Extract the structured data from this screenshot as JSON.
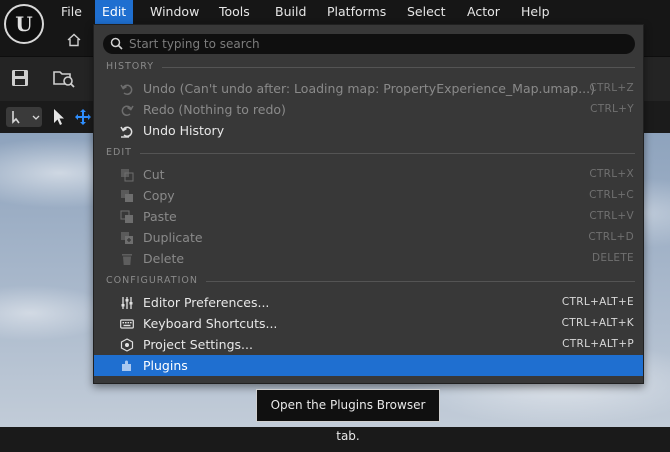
{
  "app": {
    "logo_glyph": "U",
    "menu": [
      {
        "label": "File"
      },
      {
        "label": "Edit",
        "active": true
      },
      {
        "label": "Window"
      },
      {
        "label": "Tools"
      },
      {
        "label": "Build"
      },
      {
        "label": "Platforms"
      },
      {
        "label": "Select"
      },
      {
        "label": "Actor"
      },
      {
        "label": "Help"
      }
    ],
    "accent_color": "#1f6fd0"
  },
  "edit_menu": {
    "search": {
      "placeholder": "Start typing to search",
      "value": ""
    },
    "sections": {
      "history": "HISTORY",
      "edit": "EDIT",
      "configuration": "CONFIGURATION"
    },
    "history_items": [
      {
        "label": "Undo (Can't undo after: Loading map: PropertyExperience_Map.umap...)",
        "shortcut": "CTRL+Z",
        "icon": "undo-icon",
        "enabled": false
      },
      {
        "label": "Redo (Nothing to redo)",
        "shortcut": "CTRL+Y",
        "icon": "redo-icon",
        "enabled": false
      },
      {
        "label": "Undo History",
        "shortcut": "",
        "icon": "undo-history-icon",
        "enabled": true
      }
    ],
    "edit_items": [
      {
        "label": "Cut",
        "shortcut": "CTRL+X",
        "icon": "cut-icon",
        "enabled": false
      },
      {
        "label": "Copy",
        "shortcut": "CTRL+C",
        "icon": "copy-icon",
        "enabled": false
      },
      {
        "label": "Paste",
        "shortcut": "CTRL+V",
        "icon": "paste-icon",
        "enabled": false
      },
      {
        "label": "Duplicate",
        "shortcut": "CTRL+D",
        "icon": "duplicate-icon",
        "enabled": false
      },
      {
        "label": "Delete",
        "shortcut": "DELETE",
        "icon": "delete-icon",
        "enabled": false
      }
    ],
    "config_items": [
      {
        "label": "Editor Preferences...",
        "shortcut": "CTRL+ALT+E",
        "icon": "sliders-icon",
        "enabled": true
      },
      {
        "label": "Keyboard Shortcuts...",
        "shortcut": "CTRL+ALT+K",
        "icon": "keyboard-icon",
        "enabled": true
      },
      {
        "label": "Project Settings...",
        "shortcut": "CTRL+ALT+P",
        "icon": "project-settings-icon",
        "enabled": true
      },
      {
        "label": "Plugins",
        "shortcut": "",
        "icon": "plugin-icon",
        "enabled": true,
        "highlighted": true
      }
    ]
  },
  "tooltip": {
    "text": "Open the Plugins Browser tab."
  }
}
